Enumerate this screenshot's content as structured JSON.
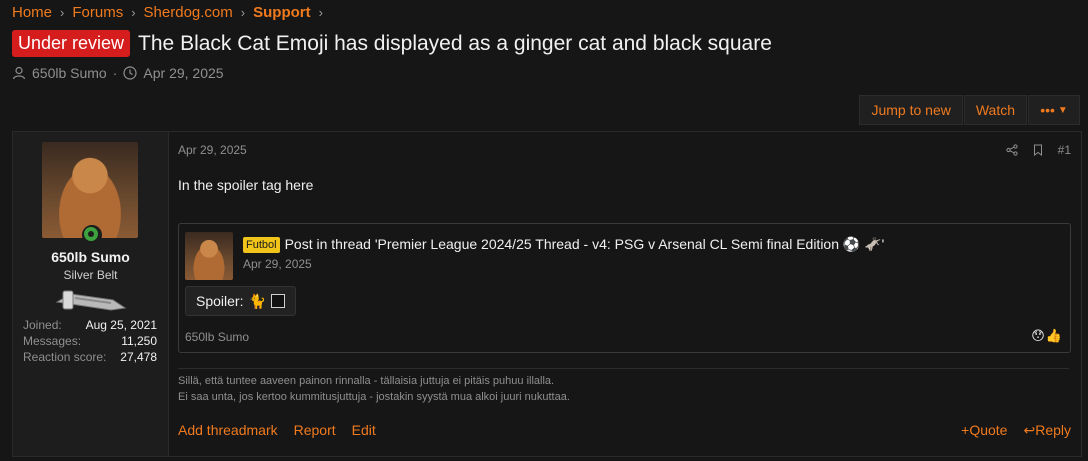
{
  "breadcrumb": [
    "Home",
    "Forums",
    "Sherdog.com",
    "Support"
  ],
  "thread": {
    "badge": "Under review",
    "title": "The Black Cat Emoji has displayed as a ginger cat and black square",
    "author": "650lb Sumo",
    "date": "Apr 29, 2025"
  },
  "toolbar": {
    "jump_label": "Jump to new",
    "watch_label": "Watch",
    "more_label": "•••"
  },
  "user": {
    "name": "650lb Sumo",
    "title": "Silver Belt",
    "stats": [
      {
        "label": "Joined:",
        "value": "Aug 25, 2021"
      },
      {
        "label": "Messages:",
        "value": "11,250"
      },
      {
        "label": "Reaction score:",
        "value": "27,478"
      }
    ]
  },
  "post": {
    "date": "Apr 29, 2025",
    "number": "#1",
    "text": "In the spoiler tag here",
    "quote": {
      "tag": "Futbol",
      "title": "Post in thread 'Premier League 2024/25 Thread - v4: PSG v Arsenal CL Semi final Edition ⚽ 🫏'",
      "date": "Apr 29, 2025",
      "spoiler_label": "Spoiler:",
      "spoiler_emoji": "🐈",
      "author": "650lb Sumo",
      "reactions": [
        "😯",
        "👍"
      ]
    },
    "signature": [
      "Sillä, että tuntee aaveen painon rinnalla - tällaisia juttuja ei pitäis puhuu illalla.",
      "Ei saa unta, jos kertoo kummitusjuttuja - jostakin syystä mua alkoi juuri nukuttaa."
    ]
  },
  "footer": {
    "add_threadmark": "Add threadmark",
    "report": "Report",
    "edit": "Edit",
    "quote": "Quote",
    "reply": "Reply"
  },
  "colors": {
    "accent": "#f07a1e",
    "badge": "#d61d1d",
    "online": "#3da13d"
  }
}
